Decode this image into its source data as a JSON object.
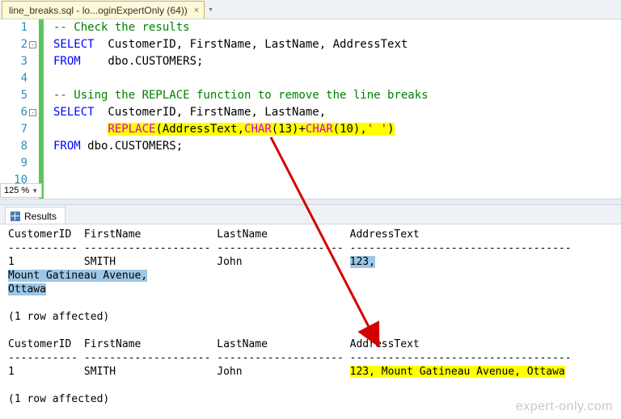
{
  "tab": {
    "title": "line_breaks.sql - lo...oginExpertOnly (64))",
    "close_glyph": "×"
  },
  "zoom": {
    "value": "125 %"
  },
  "editor": {
    "lines": [
      {
        "n": "1",
        "code": [
          [
            "cm",
            "-- Check the results"
          ]
        ]
      },
      {
        "n": "2",
        "code": [
          [
            "kw",
            "SELECT"
          ],
          [
            "tx",
            "  CustomerID, FirstName, LastName, AddressText"
          ]
        ]
      },
      {
        "n": "3",
        "code": [
          [
            "kw",
            "FROM"
          ],
          [
            "tx",
            "    dbo.CUSTOMERS;"
          ]
        ]
      },
      {
        "n": "4",
        "code": []
      },
      {
        "n": "5",
        "code": [
          [
            "cm",
            "-- Using the REPLACE function to remove the line breaks"
          ]
        ]
      },
      {
        "n": "6",
        "code": [
          [
            "kw",
            "SELECT"
          ],
          [
            "tx",
            "  CustomerID, FirstName, LastName,"
          ]
        ]
      },
      {
        "n": "7",
        "code": [
          [
            "tx",
            "        "
          ],
          [
            "hlfn",
            "REPLACE"
          ],
          [
            "hltx",
            "(AddressText,"
          ],
          [
            "hlfn",
            "CHAR"
          ],
          [
            "hltx",
            "("
          ],
          [
            "hlnum",
            "13"
          ],
          [
            "hltx",
            ")+"
          ],
          [
            "hlfn",
            "CHAR"
          ],
          [
            "hltx",
            "("
          ],
          [
            "hlnum",
            "10"
          ],
          [
            "hltx",
            "),"
          ],
          [
            "hllit",
            "' '"
          ],
          [
            "hltx",
            ")"
          ]
        ]
      },
      {
        "n": "8",
        "code": [
          [
            "kw",
            "FROM"
          ],
          [
            "tx",
            " dbo.CUSTOMERS;"
          ]
        ]
      },
      {
        "n": "9",
        "code": []
      },
      {
        "n": "10",
        "code": []
      }
    ]
  },
  "results": {
    "tab_label": "Results",
    "hdr_row": "CustomerID  FirstName            LastName             AddressText",
    "dash_row": "----------- -------------------- -------------------- -----------------------------------",
    "r1": "1           SMITH                John                 ",
    "r1_addr": "123,",
    "r1_addr2": "Mount Gatineau Avenue,",
    "r1_addr3": "Ottawa",
    "affected": "(1 row affected)",
    "r2": "1           SMITH                John                 ",
    "r2_addr": "123, Mount Gatineau Avenue, Ottawa"
  },
  "watermark": "expert-only.com"
}
